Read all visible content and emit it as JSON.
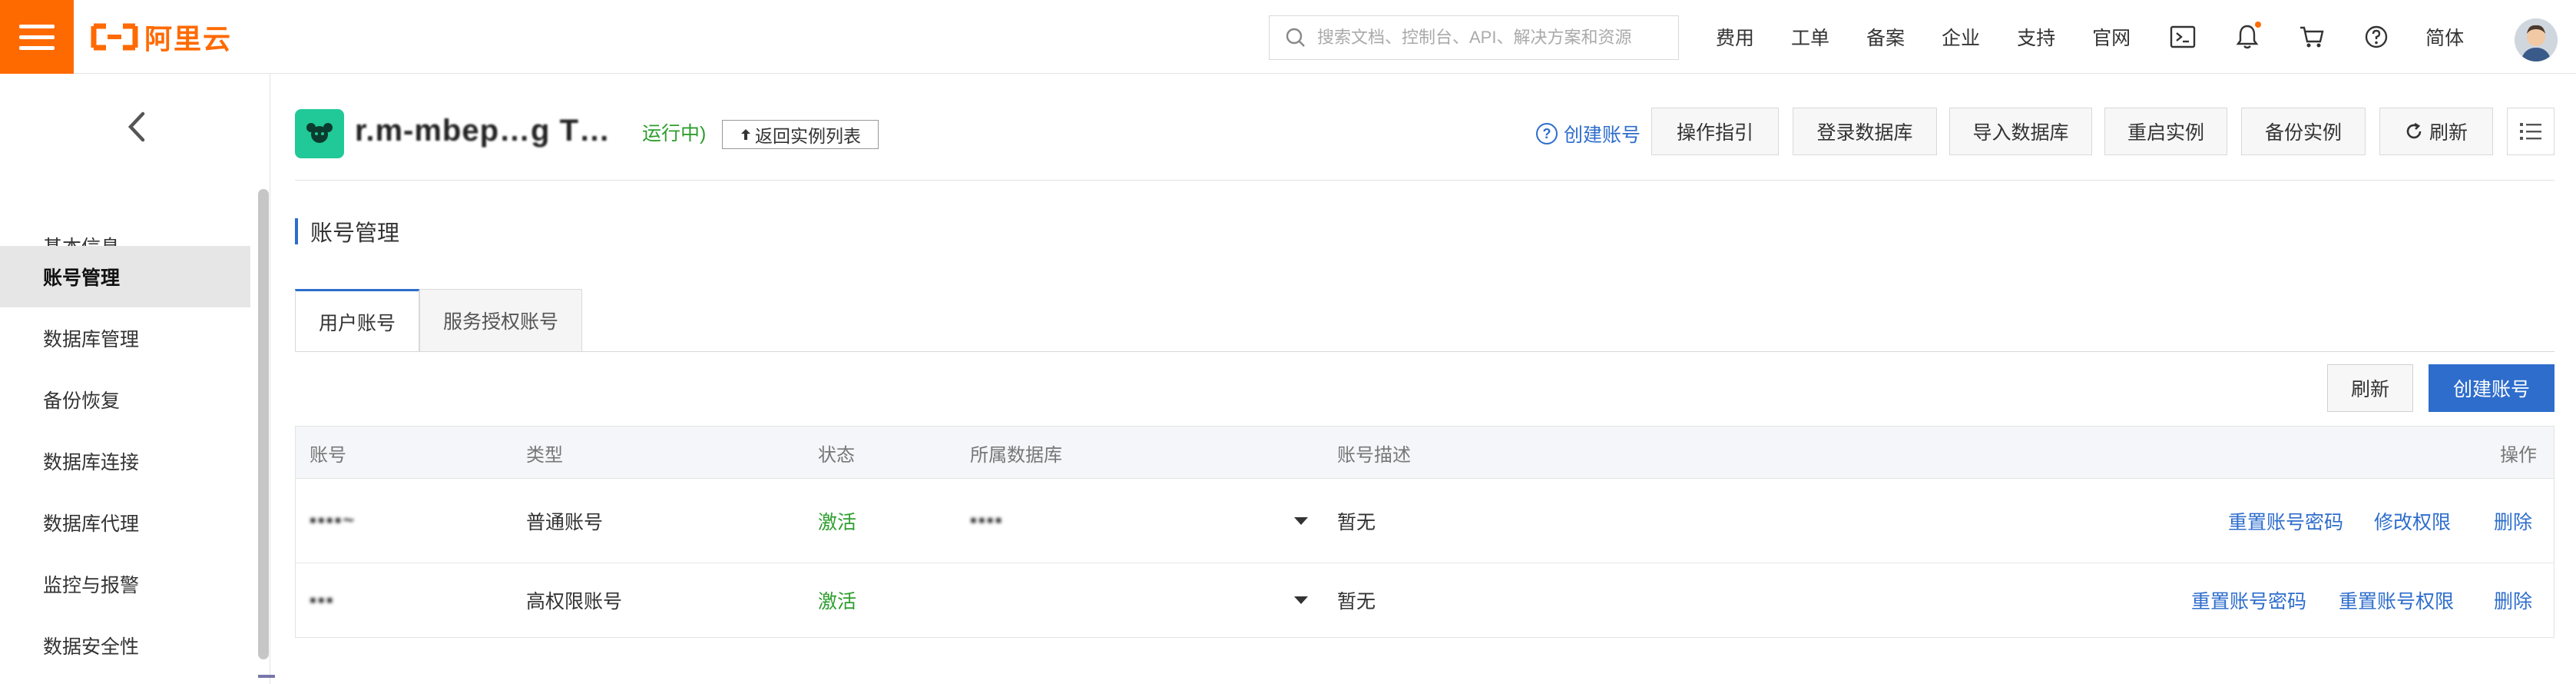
{
  "topbar": {
    "brand": "阿里云",
    "search_placeholder": "搜索文档、控制台、API、解决方案和资源",
    "links": [
      "费用",
      "工单",
      "备案",
      "企业",
      "支持",
      "官网"
    ],
    "lang": "简体",
    "accent": "#ff6a00"
  },
  "sidebar": {
    "items": [
      {
        "label": "基本信息"
      },
      {
        "label": "账号管理",
        "active": true
      },
      {
        "label": "数据库管理"
      },
      {
        "label": "备份恢复"
      },
      {
        "label": "数据库连接"
      },
      {
        "label": "数据库代理"
      },
      {
        "label": "监控与报警"
      },
      {
        "label": "数据安全性"
      }
    ]
  },
  "header": {
    "instance_name": "r.m-mbep…g T…",
    "instance_status": "运行中)",
    "back_label": "返回实例列表",
    "help_link": "创建账号",
    "buttons": [
      "操作指引",
      "登录数据库",
      "导入数据库",
      "重启实例",
      "备份实例",
      "刷新"
    ]
  },
  "section": {
    "title": "账号管理"
  },
  "tabs": [
    {
      "label": "用户账号",
      "active": true
    },
    {
      "label": "服务授权账号"
    }
  ],
  "actions": {
    "refresh": "刷新",
    "create": "创建账号"
  },
  "table": {
    "columns": [
      "账号",
      "类型",
      "状态",
      "所属数据库",
      "账号描述",
      "操作"
    ],
    "rows": [
      {
        "account": "▪▪▪▪~",
        "type": "普通账号",
        "status": "激活",
        "database": "▪▪▪▪",
        "description": "暂无",
        "ops": [
          "重置账号密码",
          "修改权限",
          "删除"
        ]
      },
      {
        "account": "▪▪▪",
        "type": "高权限账号",
        "status": "激活",
        "database": "",
        "description": "暂无",
        "ops": [
          "重置账号密码",
          "重置账号权限",
          "删除"
        ]
      }
    ]
  },
  "colors": {
    "primary": "#2e6dcc",
    "success": "#2e9e2e"
  }
}
